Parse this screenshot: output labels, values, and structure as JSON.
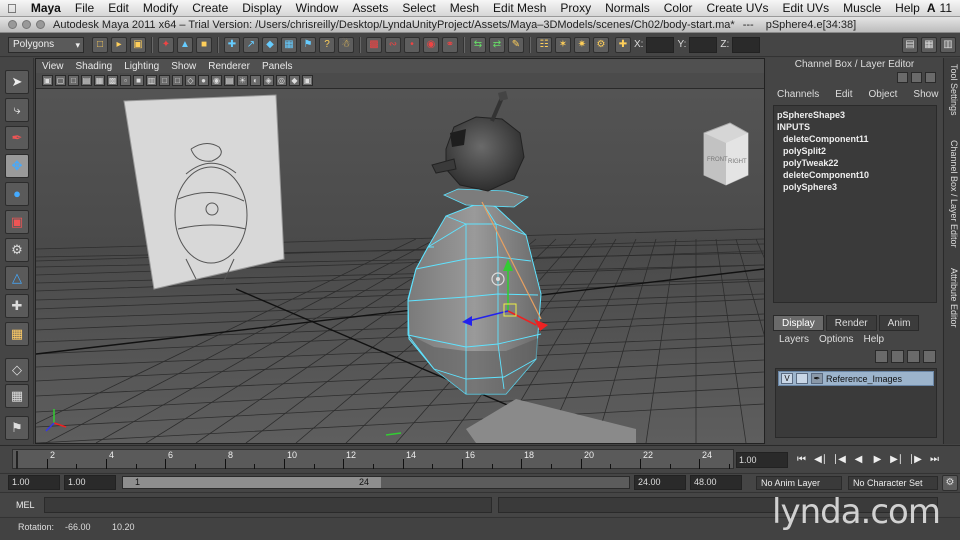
{
  "menubar": {
    "app": "Maya",
    "items": [
      "File",
      "Edit",
      "Modify",
      "Create",
      "Display",
      "Window",
      "Assets",
      "Select",
      "Mesh",
      "Edit Mesh",
      "Proxy",
      "Normals",
      "Color",
      "Create UVs",
      "Edit UVs",
      "Muscle",
      "Help"
    ],
    "right_badge": "11"
  },
  "window": {
    "title": "Autodesk Maya 2011 x64 – Trial Version: /Users/chrisreilly/Desktop/LyndaUnityProject/Assets/Maya–3DModels/scenes/Ch02/body-start.ma*",
    "separator": "---",
    "selection": "pSphere4.e[34:38]"
  },
  "statusline": {
    "menuset": "Polygons",
    "x_label": "X:",
    "y_label": "Y:",
    "z_label": "Z:"
  },
  "viewport": {
    "menus": [
      "View",
      "Shading",
      "Lighting",
      "Show",
      "Renderer",
      "Panels"
    ],
    "viewcube_labels": [
      "RIGHT",
      "FRONT"
    ]
  },
  "rightpanel": {
    "title": "Channel Box / Layer Editor",
    "menus": [
      "Channels",
      "Edit",
      "Object",
      "Show"
    ],
    "node": "pSphereShape3",
    "inputs_header": "INPUTS",
    "inputs": [
      "deleteComponent11",
      "polySplit2",
      "polyTweak22",
      "deleteComponent10",
      "polySphere3"
    ],
    "layer_tabs": [
      "Display",
      "Render",
      "Anim"
    ],
    "active_layer_tab": "Display",
    "layer_menus": [
      "Layers",
      "Options",
      "Help"
    ],
    "layer_visible": "V",
    "layer_name": "Reference_Images",
    "vertical_tabs": [
      "Tool Settings",
      "Channel Box / Layer Editor",
      "Attribute Editor"
    ]
  },
  "timeline": {
    "ticks": [
      "2",
      "4",
      "6",
      "8",
      "10",
      "12",
      "14",
      "16",
      "18",
      "20",
      "22",
      "24"
    ],
    "current_time": "1.00",
    "current_frame": 1
  },
  "range": {
    "start": "1.00",
    "playback_start": "1.00",
    "thumb_start": "1",
    "thumb_end": "24",
    "playback_end": "24.00",
    "end": "48.00",
    "anim_layer": "No Anim Layer",
    "char_set": "No Character Set"
  },
  "cmdline": {
    "label": "MEL"
  },
  "helpline": {
    "label": "Rotation:",
    "v1": "-66.00",
    "v2": "10.20"
  },
  "watermark": "lynda.com",
  "colors": {
    "wireframe_selected": "#5fe3ff",
    "grid": "#2a2a2a",
    "manip_y": "#3c3",
    "manip_x": "#e22"
  }
}
